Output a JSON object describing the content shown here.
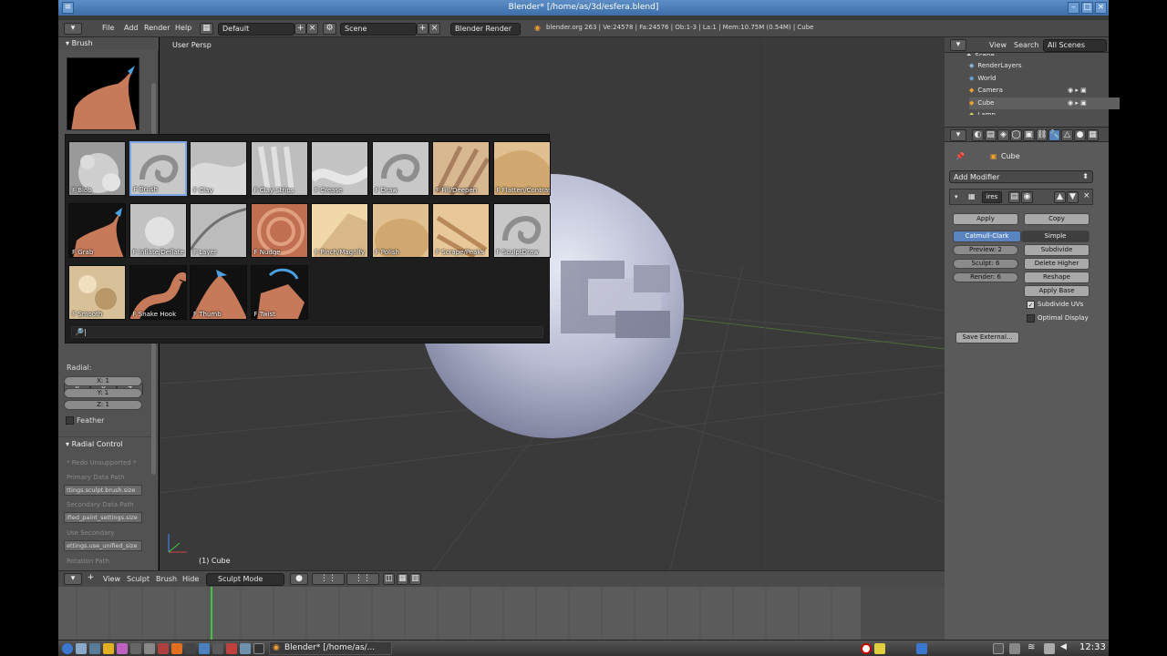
{
  "window": {
    "title": "Blender* [/home/as/3d/esfera.blend]"
  },
  "header": {
    "menus": [
      "File",
      "Add",
      "Render",
      "Help"
    ],
    "layout": "Default",
    "scene": "Scene",
    "engine": "Blender Render",
    "stats": "blender.org 263 | Ve:24578 | Fa:24576 | Ob:1-3 | La:1 | Mem:10.75M (0.54M) | Cube"
  },
  "toolshelf": {
    "brush_panel": "Brush",
    "axis": [
      "X",
      "Y",
      "Z"
    ],
    "radial_label": "Radial:",
    "radial_x": "X: 1",
    "radial_y": "Y: 1",
    "radial_z": "Z: 1",
    "feather": "Feather",
    "radial_control": "Radial Control",
    "redo": "* Redo Unsupported *",
    "primary_path_label": "Primary Data Path",
    "primary_path": "ttings.sculpt.brush.size",
    "secondary_path_label": "Secondary Data Path",
    "secondary_path": "ified_paint_settings.size",
    "use_secondary_label": "Use Secondary",
    "use_secondary": "ettings.use_unified_size",
    "rotation_path_label": "Rotation Path"
  },
  "brushes": [
    {
      "label": "F Blob",
      "style": "blob"
    },
    {
      "label": "F Brush",
      "style": "swirl",
      "selected": true
    },
    {
      "label": "F Clay",
      "style": "clay"
    },
    {
      "label": "F Clay Strips",
      "style": "claystrips"
    },
    {
      "label": "F Crease",
      "style": "crease"
    },
    {
      "label": "F Draw",
      "style": "swirl"
    },
    {
      "label": "F Fill/Deepen",
      "style": "fill"
    },
    {
      "label": "F Flatten/Contrast",
      "style": "flatten"
    },
    {
      "label": "F Grab",
      "style": "grab"
    },
    {
      "label": "F Inflate/Deflate",
      "style": "inflate"
    },
    {
      "label": "F Layer",
      "style": "layer"
    },
    {
      "label": "F Nudge",
      "style": "nudge"
    },
    {
      "label": "F Pinch/Magnify",
      "style": "pinch"
    },
    {
      "label": "F Polish",
      "style": "polish"
    },
    {
      "label": "F Scrape/Peaks",
      "style": "scrape"
    },
    {
      "label": "F SculptDraw",
      "style": "swirl"
    },
    {
      "label": "F Smooth",
      "style": "smooth"
    },
    {
      "label": "F Snake Hook",
      "style": "snake"
    },
    {
      "label": "F Thumb",
      "style": "thumb"
    },
    {
      "label": "F Twist",
      "style": "twist"
    }
  ],
  "viewport": {
    "view_label": "User Persp",
    "object_label": "(1) Cube"
  },
  "outliner": {
    "menus": [
      "View",
      "Search"
    ],
    "filter": "All Scenes",
    "items": [
      "Scene",
      "RenderLayers",
      "World",
      "Camera",
      "Cube",
      "Lamp"
    ]
  },
  "properties": {
    "object": "Cube",
    "add_modifier": "Add Modifier",
    "modifier_name": "ires",
    "apply": "Apply",
    "copy": "Copy",
    "catmull": "Catmull-Clark",
    "simple": "Simple",
    "preview": "Preview: 2",
    "sculpt": "Sculpt: 6",
    "render": "Render: 6",
    "subdivide": "Subdivide",
    "delete_higher": "Delete Higher",
    "reshape": "Reshape",
    "apply_base": "Apply Base",
    "subdivide_uvs": "Subdivide UVs",
    "optimal_display": "Optimal Display",
    "save_external": "Save External..."
  },
  "bottom": {
    "menus": [
      "View",
      "Sculpt",
      "Brush",
      "Hide"
    ],
    "mode": "Sculpt Mode"
  },
  "taskbar": {
    "task": "Blender* [/home/as/...",
    "clock": "12:33"
  }
}
